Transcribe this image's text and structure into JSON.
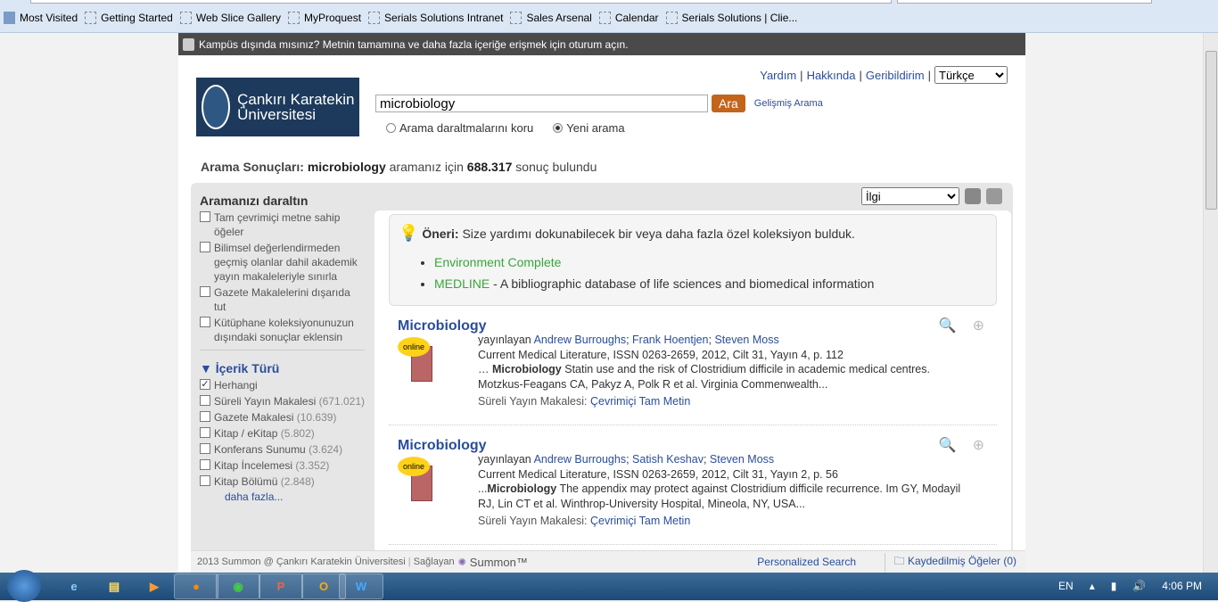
{
  "browser": {
    "bookmarks": [
      "Most Visited",
      "Getting Started",
      "Web Slice Gallery",
      "MyProquest",
      "Serials Solutions Intranet",
      "Sales Arsenal",
      "Calendar",
      "Serials Solutions | Clie..."
    ]
  },
  "banner": "Kampüs dışında mısınız? Metnin tamamına ve daha fazla içeriğe erişmek için oturum açın.",
  "toplinks": {
    "help": "Yardım",
    "about": "Hakkında",
    "feedback": "Geribildirim",
    "language": "Türkçe"
  },
  "logo": {
    "text": "Çankırı Karatekin Üniversitesi"
  },
  "search": {
    "query": "microbiology",
    "button": "Ara",
    "advanced": "Gelişmiş Arama",
    "keep": "Arama daraltmalarını koru",
    "new": "Yeni arama",
    "new_selected": true
  },
  "summary": {
    "label": "Arama Sonuçları:",
    "query": "microbiology",
    "mid": "aramanız için",
    "count": "688.317",
    "end": "sonuç bulundu"
  },
  "sort": {
    "value": "İlgi"
  },
  "facets": {
    "title": "Aramanızı daraltın",
    "options": [
      {
        "label": "Tam çevrimiçi metne sahip öğeler",
        "checked": false
      },
      {
        "label": "Bilimsel değerlendirmeden geçmiş olanlar dahil akademik yayın makaleleriyle sınırla",
        "checked": false
      },
      {
        "label": "Gazete Makalelerini dışarıda tut",
        "checked": false
      },
      {
        "label": "Kütüphane koleksiyonunuzun dışındaki sonuçlar eklensin",
        "checked": false
      }
    ],
    "content_type_title": "İçerik Türü",
    "content_types": [
      {
        "label": "Herhangi",
        "count": "",
        "checked": true
      },
      {
        "label": "Süreli Yayın Makalesi",
        "count": "(671.021)",
        "checked": false
      },
      {
        "label": "Gazete Makalesi",
        "count": "(10.639)",
        "checked": false
      },
      {
        "label": "Kitap / eKitap",
        "count": "(5.802)",
        "checked": false
      },
      {
        "label": "Konferans Sunumu",
        "count": "(3.624)",
        "checked": false
      },
      {
        "label": "Kitap İncelemesi",
        "count": "(3.352)",
        "checked": false
      },
      {
        "label": "Kitap Bölümü",
        "count": "(2.848)",
        "checked": false
      }
    ],
    "more": "daha fazla..."
  },
  "recommendation": {
    "label": "Öneri:",
    "text": "Size yardımı dokunabilecek bir veya daha fazla özel koleksiyon bulduk.",
    "items": [
      {
        "name": "Environment Complete",
        "desc": ""
      },
      {
        "name": "MEDLINE",
        "desc": " - A bibliographic database of life sciences and biomedical information"
      }
    ]
  },
  "results": [
    {
      "title": "Microbiology",
      "badge": "online",
      "by": "yayınlayan",
      "authors": [
        "Andrew Burroughs",
        "Frank Hoentjen",
        "Steven Moss"
      ],
      "source": "Current Medical Literature, ISSN 0263-2659, 2012, Cilt 31, Yayın 4, p. 112",
      "snip_pre": "…  ",
      "snip_bold": "Microbiology",
      "snip": " Statin use and the risk of Clostridium difficile in academic medical centres. Motzkus-Feagans CA, Pakyz A, Polk R et al. Virginia Commenwealth...",
      "type": "Süreli Yayın Makalesi:",
      "link": "Çevrimiçi Tam Metin"
    },
    {
      "title": "Microbiology",
      "badge": "online",
      "by": "yayınlayan",
      "authors": [
        "Andrew Burroughs",
        "Satish Keshav",
        "Steven Moss"
      ],
      "source": "Current Medical Literature, ISSN 0263-2659, 2012, Cilt 31, Yayın 2, p. 56",
      "snip_pre": "...",
      "snip_bold": "Microbiology",
      "snip": " The appendix may protect against Clostridium difficile recurrence. Im GY, Modayil RJ, Lin CT et al. Winthrop-University Hospital, Mineola, NY, USA...",
      "type": "Süreli Yayın Makalesi:",
      "link": "Çevrimiçi Tam Metin"
    }
  ],
  "footer": {
    "copy": "2013 Summon @ Çankırı Karatekin Üniversitesi",
    "powered": "Sağlayan",
    "brand": "Summon™",
    "personalized": "Personalized Search",
    "saved": "Kaydedilmiş Öğeler (0)"
  },
  "taskbar": {
    "lang": "EN",
    "time": "4:06 PM"
  }
}
